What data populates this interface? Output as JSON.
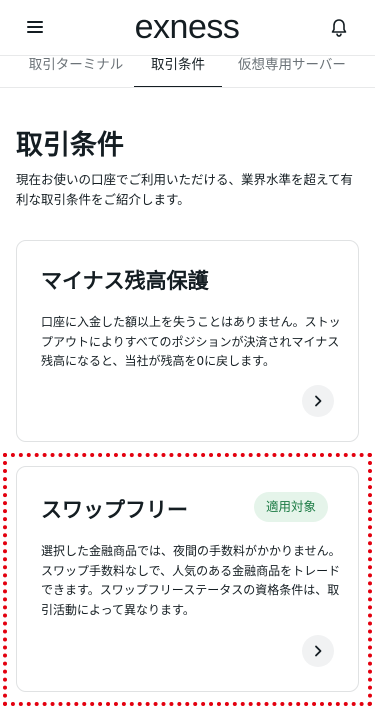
{
  "header": {
    "logo_text": "exness",
    "menu_icon": "hamburger-menu-icon",
    "bell_icon": "bell-icon"
  },
  "tabs": [
    {
      "label": "取引ターミナル"
    },
    {
      "label": "取引条件",
      "active": true
    },
    {
      "label": "仮想専用サーバー"
    }
  ],
  "main": {
    "title": "取引条件",
    "intro": "現在お使いの口座でご利用いただける、業界水準を超えて有利な取引条件をご紹介します。"
  },
  "cards": [
    {
      "title": "マイナス残高保護",
      "description": "口座に入金した額以上を失うことはありません。ストップアウトによりすべてのポジションが決済されマイナス残高になると、当社が残高を0に戻します。",
      "arrow_icon": "chevron-right-icon"
    },
    {
      "title": "スワップフリー",
      "badge": "適用対象",
      "description": "選択した金融商品では、夜間の手数料がかかりません。スワップ手数料なしで、人気のある金融商品をトレードできます。スワップフリーステータスの資格条件は、取引活動によって異なります。",
      "arrow_icon": "chevron-right-icon"
    }
  ],
  "colors": {
    "text": "#141d22",
    "badge_bg": "#e5f4ea",
    "badge_text": "#1a7a43",
    "highlight": "#e3000f"
  }
}
